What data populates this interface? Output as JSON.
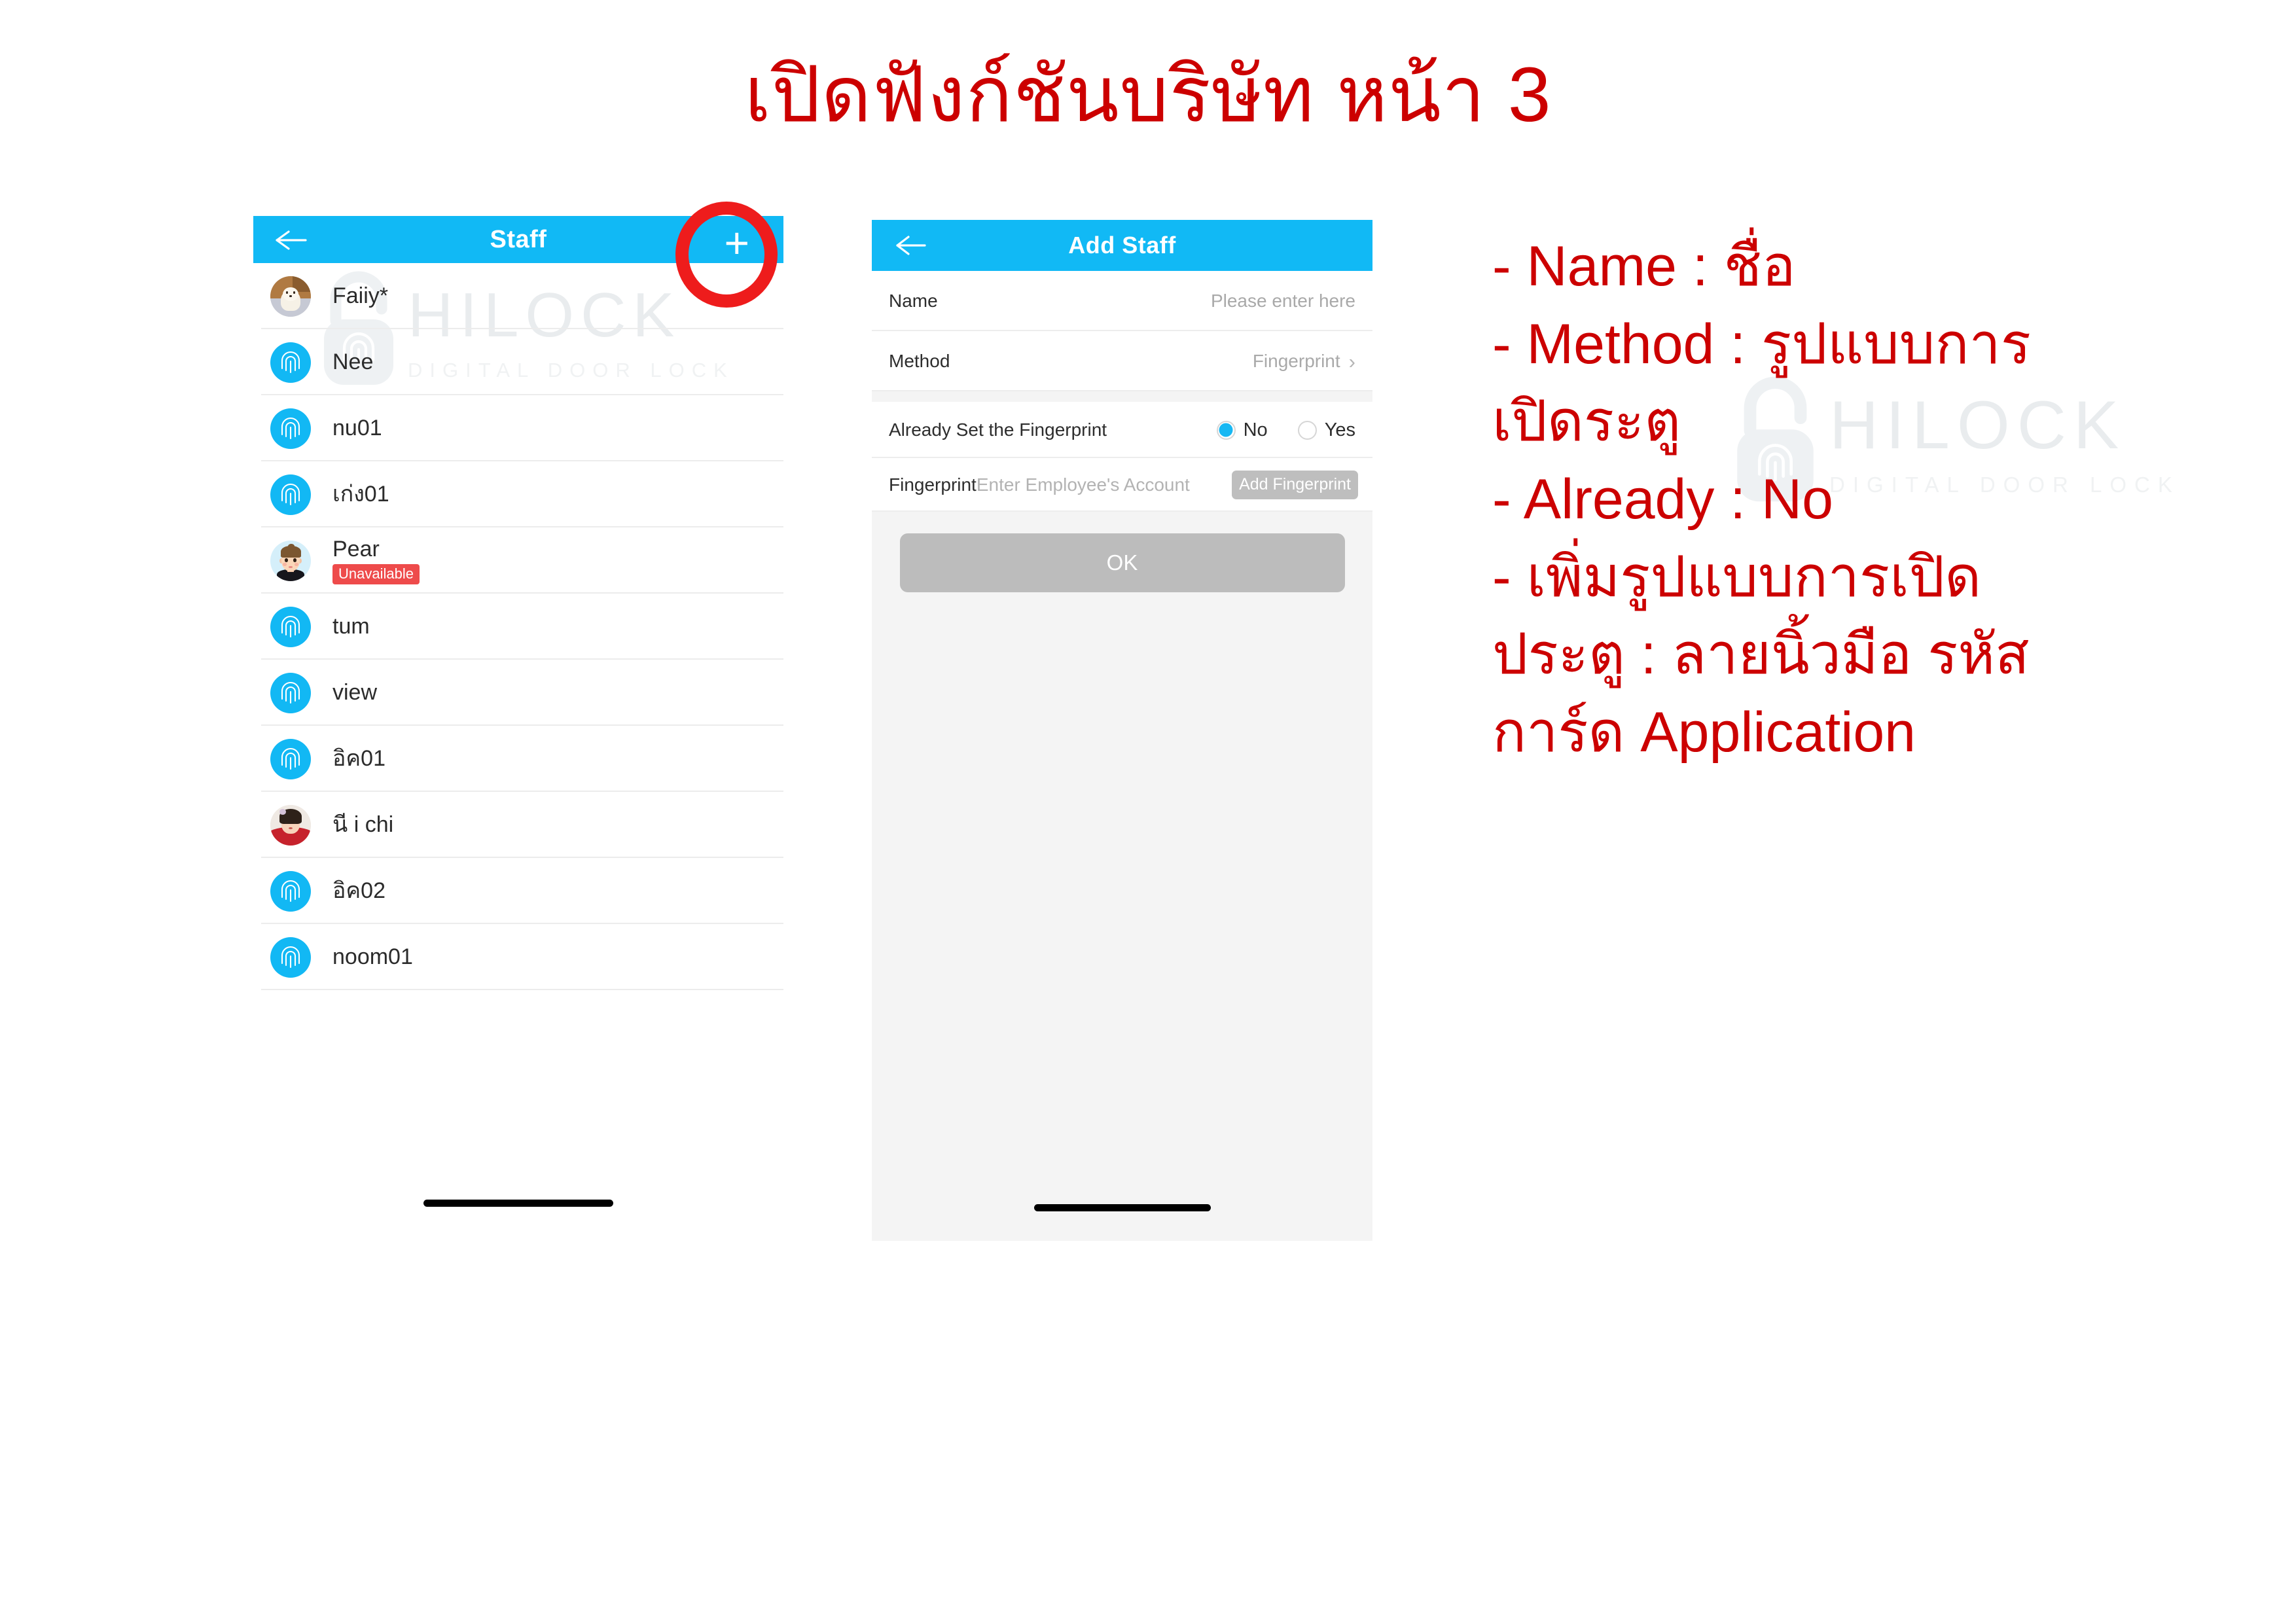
{
  "title": "เปิดฟังก์ชันบริษัท หน้า 3",
  "brand": {
    "accent": "#11b9f5",
    "red": "#cc0000",
    "badge_red": "#ee4b4b",
    "watermark_main": "HILOCK",
    "watermark_sub": "DIGITAL DOOR LOCK"
  },
  "staff_screen": {
    "appbar": {
      "title": "Staff",
      "back_icon": "back-arrow-icon",
      "add_icon": "plus-icon",
      "add_label": "+"
    },
    "rows": [
      {
        "name": "Faiiy*",
        "avatar": "photo-dog",
        "badge": ""
      },
      {
        "name": "Nee",
        "avatar": "fingerprint",
        "badge": ""
      },
      {
        "name": "nu01",
        "avatar": "fingerprint",
        "badge": ""
      },
      {
        "name": "เก่ง01",
        "avatar": "fingerprint",
        "badge": ""
      },
      {
        "name": "Pear",
        "avatar": "cartoon-face",
        "badge": "Unavailable"
      },
      {
        "name": "tum",
        "avatar": "fingerprint",
        "badge": ""
      },
      {
        "name": "view",
        "avatar": "fingerprint",
        "badge": ""
      },
      {
        "name": "อิค01",
        "avatar": "fingerprint",
        "badge": ""
      },
      {
        "name": "นี i chi",
        "avatar": "photo-girl",
        "badge": ""
      },
      {
        "name": "อิค02",
        "avatar": "fingerprint",
        "badge": ""
      },
      {
        "name": "noom01",
        "avatar": "fingerprint",
        "badge": ""
      }
    ]
  },
  "add_staff_screen": {
    "appbar": {
      "title": "Add Staff",
      "back_icon": "back-arrow-icon"
    },
    "name_row": {
      "label": "Name",
      "placeholder": "Please enter here",
      "value": ""
    },
    "method_row": {
      "label": "Method",
      "value": "Fingerprint",
      "chevron": "›"
    },
    "already_row": {
      "label": "Already Set the Fingerprint",
      "options": [
        {
          "label": "No",
          "selected": true
        },
        {
          "label": "Yes",
          "selected": false
        }
      ]
    },
    "fingerprint_row": {
      "label": "Fingerprint",
      "placeholder": "Enter Employee's Account",
      "value": "",
      "button": "Add Fingerprint"
    },
    "ok_button": "OK"
  },
  "annotations": {
    "lines": [
      "- Name : ชื่อ",
      "- Method : รูปแบบการเปิดระตู",
      "- Already : No",
      "- เพิ่มรูปแบบการเปิดประตู : ลายนิ้วมือ รหัส การ์ด Application"
    ],
    "line1": "- Name : ชื่อ",
    "line2": "- Method : รูปแบบการ",
    "line3": "เปิดระตู",
    "line4": "- Already : No",
    "line5": "- เพิ่มรูปแบบการเปิด",
    "line6": "ประตู : ลายนิ้วมือ รหัส",
    "line7": "การ์ด Application",
    "highlight_target": "add-staff-plus-button"
  }
}
